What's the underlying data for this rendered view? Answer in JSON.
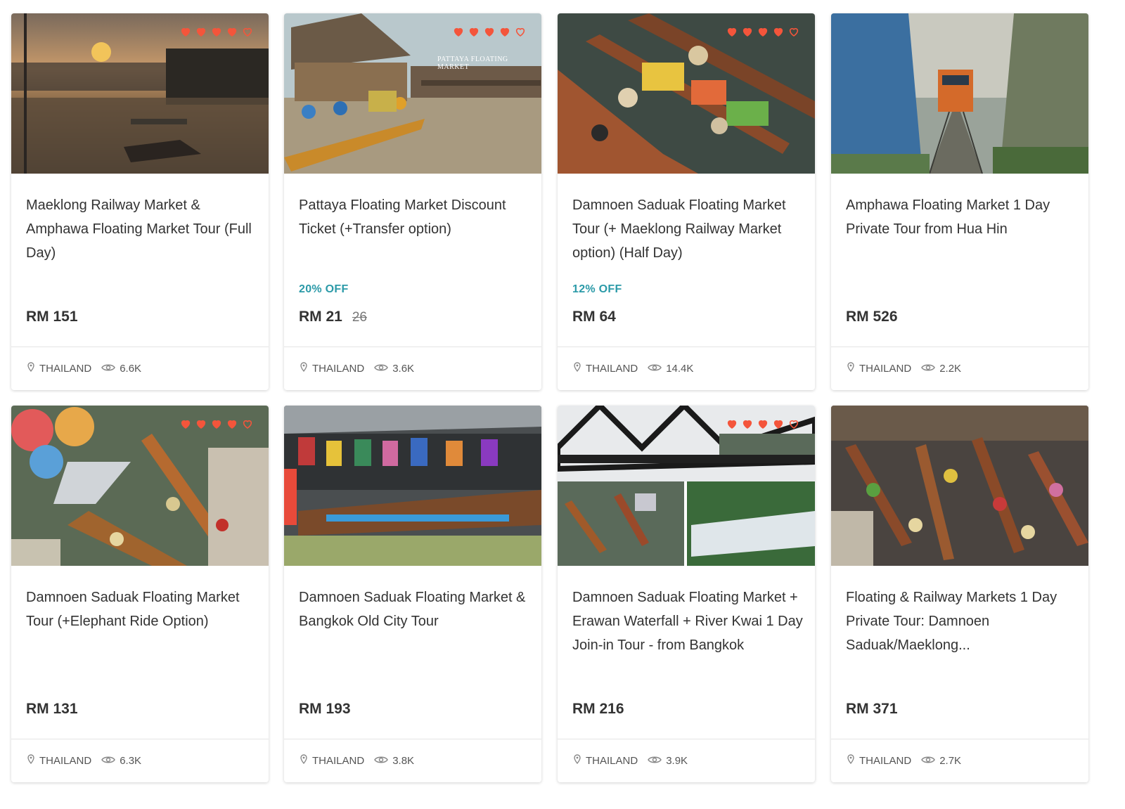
{
  "cards": [
    {
      "title": "Maeklong Railway Market & Amphawa Floating Market Tour (Full Day)",
      "discount": "",
      "price": "RM 151",
      "old_price": "",
      "country": "THAILAND",
      "views": "6.6K",
      "hearts": 5,
      "hearts_filled": 4
    },
    {
      "title": "Pattaya Floating Market Discount Ticket (+Transfer option)",
      "discount": "20% OFF",
      "price": "RM 21",
      "old_price": "26",
      "country": "THAILAND",
      "views": "3.6K",
      "hearts": 5,
      "hearts_filled": 4
    },
    {
      "title": "Damnoen Saduak Floating Market Tour (+ Maeklong Railway Market option) (Half Day)",
      "discount": "12% OFF",
      "price": "RM 64",
      "old_price": "",
      "country": "THAILAND",
      "views": "14.4K",
      "hearts": 5,
      "hearts_filled": 4
    },
    {
      "title": "Amphawa Floating Market 1 Day Private Tour from Hua Hin",
      "discount": "",
      "price": "RM 526",
      "old_price": "",
      "country": "THAILAND",
      "views": "2.2K",
      "hearts": 0,
      "hearts_filled": 0
    },
    {
      "title": "Damnoen Saduak Floating Market Tour (+Elephant Ride Option)",
      "discount": "",
      "price": "RM 131",
      "old_price": "",
      "country": "THAILAND",
      "views": "6.3K",
      "hearts": 5,
      "hearts_filled": 4
    },
    {
      "title": "Damnoen Saduak Floating Market & Bangkok Old City Tour",
      "discount": "",
      "price": "RM 193",
      "old_price": "",
      "country": "THAILAND",
      "views": "3.8K",
      "hearts": 0,
      "hearts_filled": 0
    },
    {
      "title": "Damnoen Saduak Floating Market + Erawan Waterfall + River Kwai 1 Day Join-in Tour - from Bangkok",
      "discount": "",
      "price": "RM 216",
      "old_price": "",
      "country": "THAILAND",
      "views": "3.9K",
      "hearts": 5,
      "hearts_filled": 4
    },
    {
      "title": "Floating & Railway Markets 1 Day Private Tour: Damnoen Saduak/Maeklong...",
      "discount": "",
      "price": "RM 371",
      "old_price": "",
      "country": "THAILAND",
      "views": "2.7K",
      "hearts": 0,
      "hearts_filled": 0
    }
  ],
  "photo_overlays": {
    "pattaya_sign": "PATTAYA FLOATING MARKET"
  },
  "colors": {
    "heart": "#f4553b",
    "discount": "#2b9aa8",
    "title": "#333333",
    "meta": "#555555"
  }
}
